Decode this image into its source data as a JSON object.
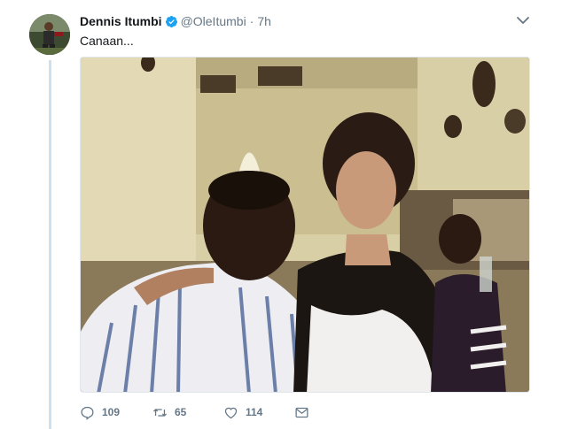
{
  "tweet": {
    "author_name": "Dennis Itumbi",
    "handle": "@OleItumbi",
    "separator": "·",
    "time": "7h",
    "text": "Canaan...",
    "verified": true
  },
  "actions": {
    "reply_count": "109",
    "retweet_count": "65",
    "like_count": "114"
  },
  "colors": {
    "verified_blue": "#1da1f2",
    "secondary_text": "#657786",
    "thread_line": "#cce1ef"
  },
  "icons": {
    "reply": "reply-icon",
    "retweet": "retweet-icon",
    "like": "heart-icon",
    "dm": "envelope-icon",
    "menu": "chevron-down-icon"
  }
}
